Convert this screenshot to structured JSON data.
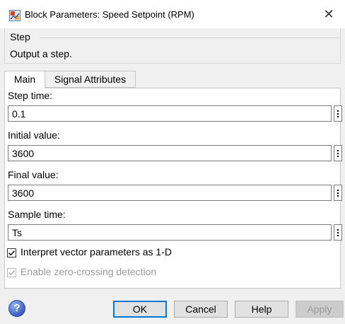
{
  "window": {
    "title": "Block Parameters: Speed Setpoint (RPM)",
    "close_glyph": "✕"
  },
  "block": {
    "group_title": "Step",
    "description": "Output a step."
  },
  "tabs": [
    {
      "label": "Main",
      "active": true
    },
    {
      "label": "Signal Attributes",
      "active": false
    }
  ],
  "fields": [
    {
      "label": "Step time:",
      "value": "0.1"
    },
    {
      "label": "Initial value:",
      "value": "3600"
    },
    {
      "label": "Final value:",
      "value": "3600"
    },
    {
      "label": "Sample time:",
      "value": "Ts"
    }
  ],
  "checkboxes": [
    {
      "label": "Interpret vector parameters as 1-D",
      "checked": true,
      "enabled": true
    },
    {
      "label": "Enable zero-crossing detection",
      "checked": true,
      "enabled": false
    }
  ],
  "buttons": {
    "ok": "OK",
    "cancel": "Cancel",
    "help": "Help",
    "apply": "Apply"
  },
  "help_icon_glyph": "?",
  "check_glyph": "✓",
  "colors": {
    "accent": "#0078d7",
    "dialog_bg": "#f0f0f0",
    "disabled_text": "#9a9a9a"
  }
}
